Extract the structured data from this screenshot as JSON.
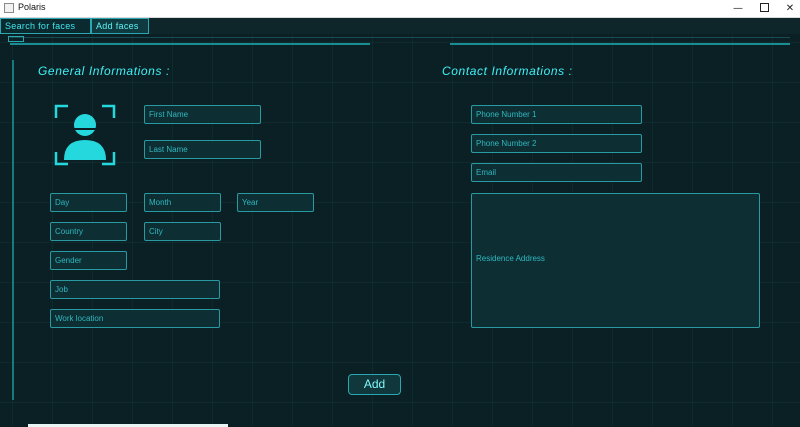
{
  "window": {
    "title": "Polaris",
    "minimize_glyph": "—",
    "close_glyph": "✕"
  },
  "tabs": [
    {
      "label": "Search for faces",
      "active": false
    },
    {
      "label": "Add faces",
      "active": true
    }
  ],
  "general": {
    "title": "General Informations :",
    "avatar_icon": "user-face-scan-icon",
    "first_name": {
      "placeholder": "First Name",
      "value": ""
    },
    "last_name": {
      "placeholder": "Last Name",
      "value": ""
    },
    "day": {
      "placeholder": "Day",
      "value": ""
    },
    "month": {
      "placeholder": "Month",
      "value": ""
    },
    "year": {
      "placeholder": "Year",
      "value": ""
    },
    "country": {
      "placeholder": "Country",
      "value": ""
    },
    "city": {
      "placeholder": "City",
      "value": ""
    },
    "gender": {
      "placeholder": "Gender",
      "value": ""
    },
    "job": {
      "placeholder": "Job",
      "value": ""
    },
    "work_location": {
      "placeholder": "Work location",
      "value": ""
    }
  },
  "contact": {
    "title": "Contact Informations :",
    "phone1": {
      "placeholder": "Phone Number 1",
      "value": ""
    },
    "phone2": {
      "placeholder": "Phone Number 2",
      "value": ""
    },
    "email": {
      "placeholder": "Email",
      "value": ""
    },
    "address": {
      "placeholder": "Residence Address",
      "value": ""
    }
  },
  "actions": {
    "add_label": "Add"
  },
  "colors": {
    "accent": "#3ff0f5",
    "background": "#0b2024",
    "field_border": "#2a9aa2"
  }
}
